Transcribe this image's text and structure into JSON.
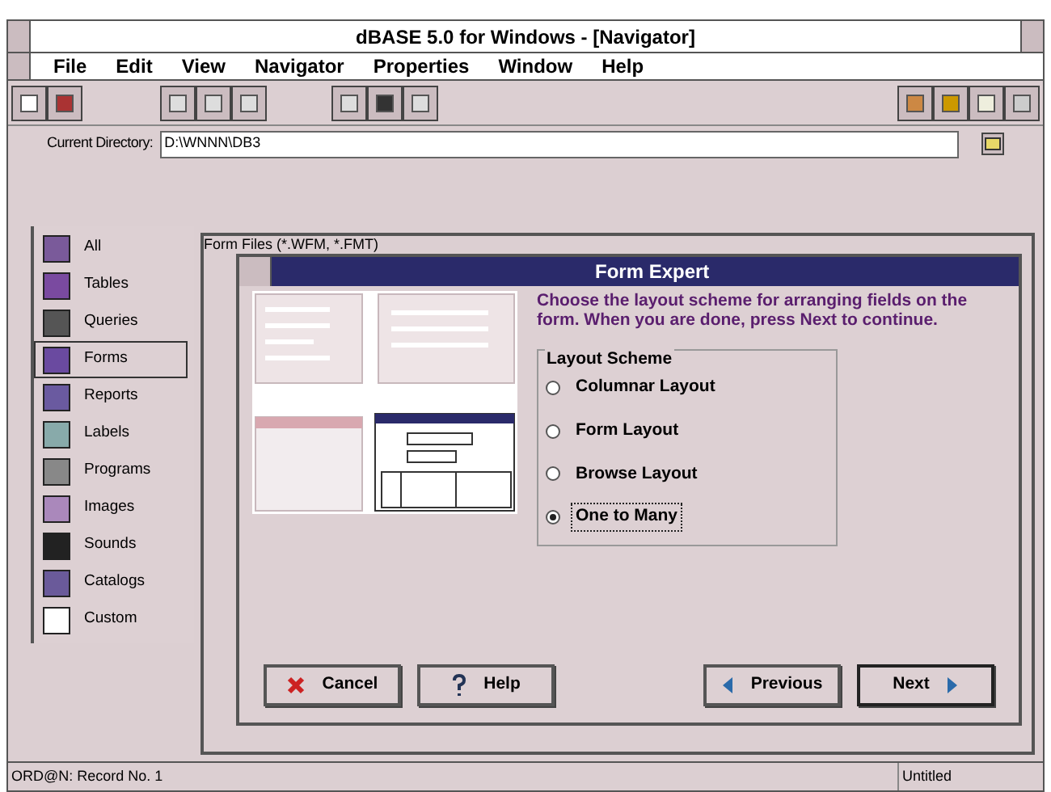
{
  "window": {
    "title": "dBASE 5.0 for Windows - [Navigator]"
  },
  "menu": [
    "File",
    "Edit",
    "View",
    "Navigator",
    "Properties",
    "Window",
    "Help"
  ],
  "directory": {
    "label": "Current Directory:",
    "value": "D:\\WNNN\\DB3"
  },
  "sidebar": {
    "items": [
      {
        "label": "All",
        "kind": "all",
        "selected": false
      },
      {
        "label": "Tables",
        "kind": "tables",
        "selected": false
      },
      {
        "label": "Queries",
        "kind": "queries",
        "selected": false
      },
      {
        "label": "Forms",
        "kind": "forms",
        "selected": true
      },
      {
        "label": "Reports",
        "kind": "reports",
        "selected": false
      },
      {
        "label": "Labels",
        "kind": "labels",
        "selected": false
      },
      {
        "label": "Programs",
        "kind": "programs",
        "selected": false
      },
      {
        "label": "Images",
        "kind": "images",
        "selected": false
      },
      {
        "label": "Sounds",
        "kind": "sounds",
        "selected": false
      },
      {
        "label": "Catalogs",
        "kind": "catalogs",
        "selected": false
      },
      {
        "label": "Custom",
        "kind": "custom",
        "selected": false
      }
    ]
  },
  "files_window": {
    "title": "Form Files (*.WFM, *.FMT)"
  },
  "dialog": {
    "title": "Form Expert",
    "instructions": "Choose the layout scheme for arranging fields on the form.  When you are done, press Next to continue.",
    "group_label": "Layout Scheme",
    "options": [
      {
        "label": "Columnar Layout",
        "selected": false
      },
      {
        "label": "Form Layout",
        "selected": false
      },
      {
        "label": "Browse Layout",
        "selected": false
      },
      {
        "label": "One to Many",
        "selected": true
      }
    ],
    "buttons": [
      {
        "label": "Cancel",
        "kind": "cancel"
      },
      {
        "label": "Help",
        "kind": "help"
      },
      {
        "label": "Previous",
        "kind": "previous"
      },
      {
        "label": "Next",
        "kind": "next"
      }
    ]
  },
  "status_bar": {
    "left": "ORD@N: Record No. 1",
    "right": "Untitled"
  }
}
